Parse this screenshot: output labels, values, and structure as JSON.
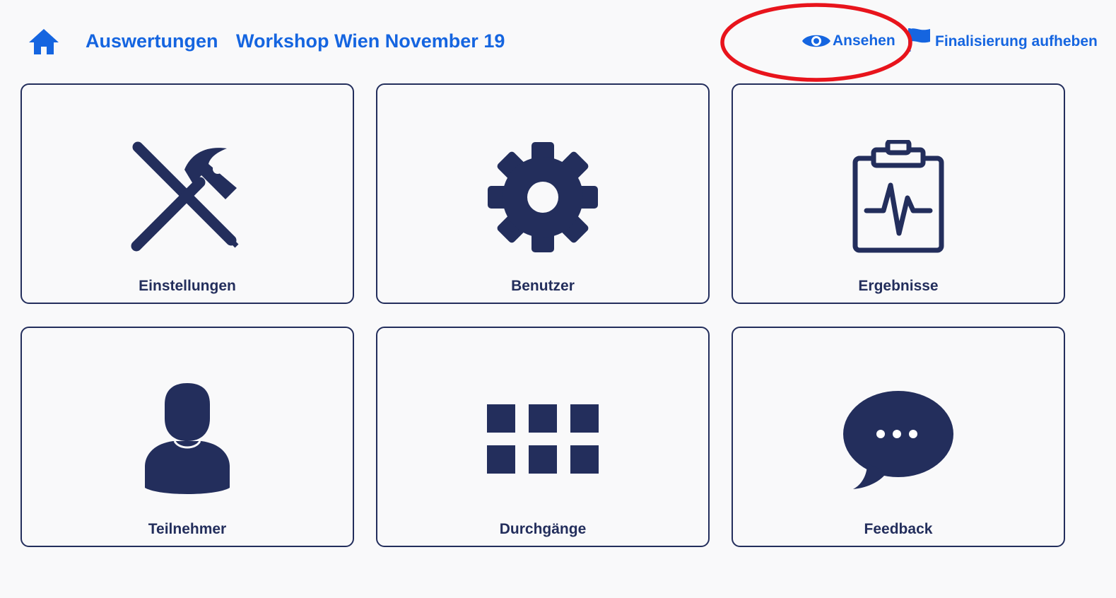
{
  "header": {
    "home_icon": "home-icon",
    "breadcrumbs": [
      "Auswertungen",
      "Workshop Wien November 19"
    ],
    "actions": {
      "view_label": "Ansehen",
      "view_icon": "eye-icon",
      "unfinalize_label": "Finalisierung aufheben",
      "unfinalize_icon": "flag-icon"
    }
  },
  "tiles": [
    {
      "label": "Einstellungen",
      "icon": "tools-icon"
    },
    {
      "label": "Benutzer",
      "icon": "gear-icon"
    },
    {
      "label": "Ergebnisse",
      "icon": "clipboard-pulse-icon"
    },
    {
      "label": "Teilnehmer",
      "icon": "user-icon"
    },
    {
      "label": "Durchgänge",
      "icon": "grid-icon"
    },
    {
      "label": "Feedback",
      "icon": "speech-bubble-icon"
    }
  ],
  "colors": {
    "link": "#1565e0",
    "tile_ink": "#232e5c",
    "background": "#f9f9fa",
    "annotation": "#e8141c"
  }
}
